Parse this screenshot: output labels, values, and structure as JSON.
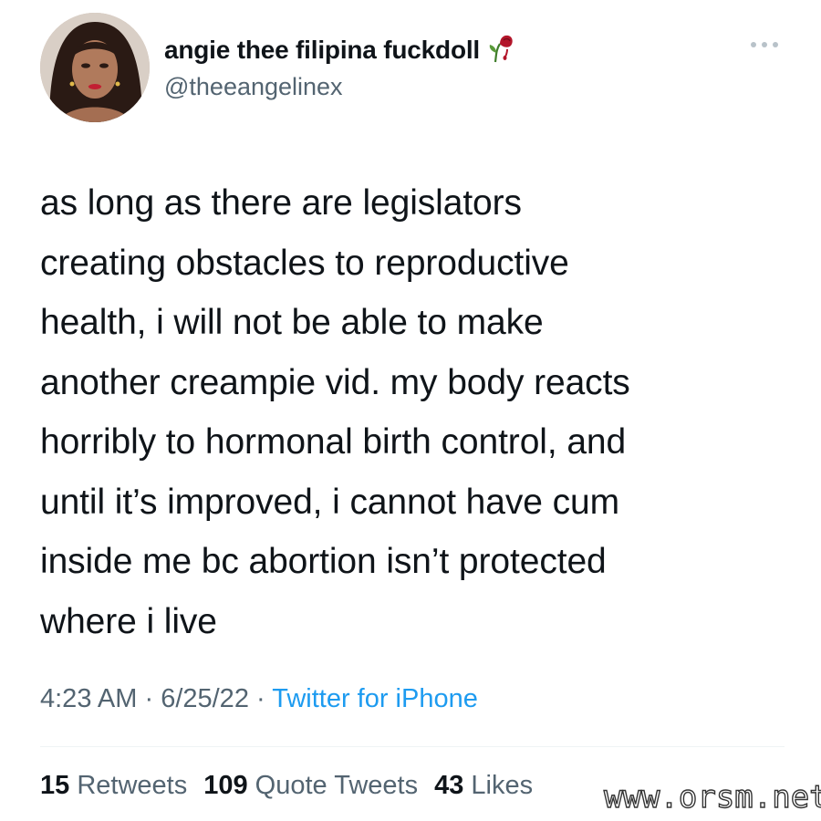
{
  "author": {
    "display_name": "angie thee filipina fuckdoll",
    "handle": "@theeangelinex",
    "name_emoji_icon": "wilted-rose-icon",
    "avatar_icon": "profile-photo"
  },
  "tweet": {
    "text": "as long as there are legislators\ncreating obstacles to reproductive\nhealth, i will not be able to make\nanother creampie vid. my body reacts\nhorribly to hormonal birth control, and\nuntil it’s improved, i cannot have cum\ninside me bc abortion isn’t protected\nwhere i live",
    "time": "4:23 AM",
    "separator": " · ",
    "date": "6/25/22",
    "source": "Twitter for iPhone"
  },
  "stats": {
    "retweets_count": "15",
    "retweets_label": "Retweets",
    "quotes_count": "109",
    "quotes_label": "Quote Tweets",
    "likes_count": "43",
    "likes_label": "Likes"
  },
  "watermark": "www.orsm.net",
  "colors": {
    "text": "#0f1419",
    "secondary": "#536471",
    "link": "#1d9bf0",
    "divider": "#eff3f4"
  }
}
